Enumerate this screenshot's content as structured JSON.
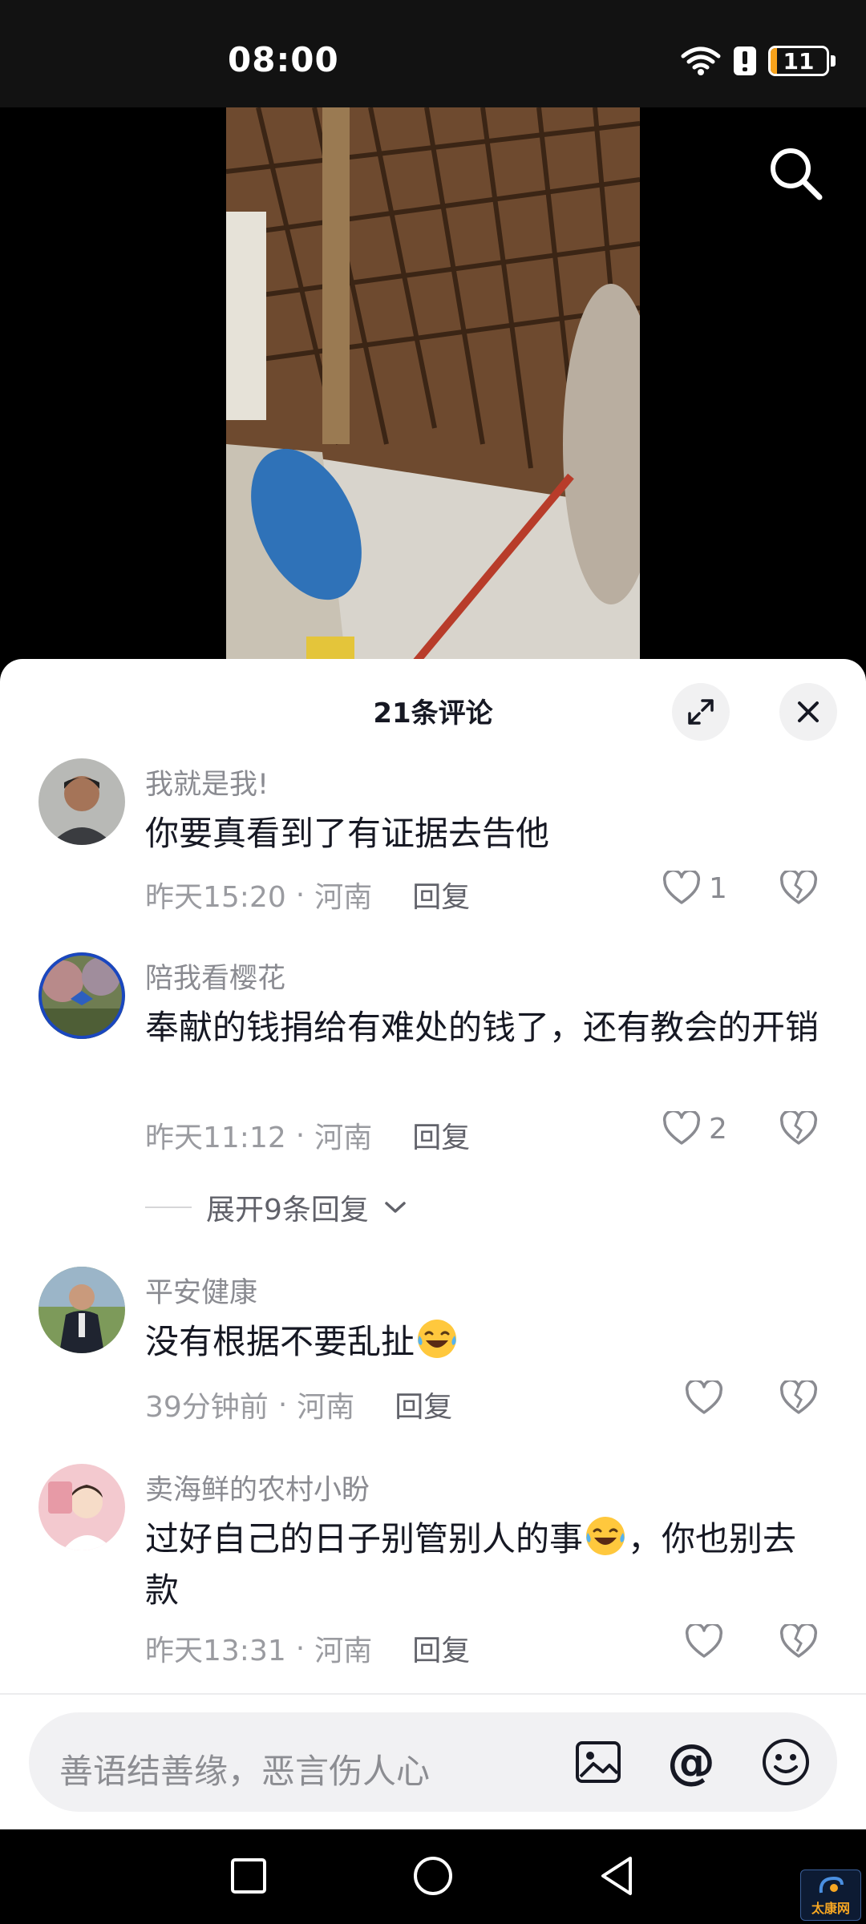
{
  "status_bar": {
    "time": "08:00",
    "battery": "11",
    "battery_color": "#f7a21b"
  },
  "comments_panel": {
    "title": "21条评论",
    "comments": [
      {
        "user": "我就是我!",
        "text": "你要真看到了有证据去告他",
        "time": "昨天15:20",
        "location": "河南",
        "reply_label": "回复",
        "likes": "1"
      },
      {
        "user": "陪我看樱花",
        "text": "奉献的钱捐给有难处的钱了，还有教会的开销",
        "time": "昨天11:12",
        "location": "河南",
        "reply_label": "回复",
        "likes": "2"
      },
      {
        "user": "平安健康",
        "text": "没有根据不要乱扯",
        "time": "39分钟前",
        "location": "河南",
        "reply_label": "回复",
        "likes": ""
      },
      {
        "user": "卖海鲜的农村小盼",
        "text_before": "过好自己的日子别管别人的事",
        "text_after": "，你也别去款",
        "time": "昨天13:31",
        "location": "河南",
        "reply_label": "回复",
        "likes": ""
      }
    ],
    "expand_replies": "展开9条回复",
    "separator": "·"
  },
  "input": {
    "placeholder": "善语结善缘，恶言伤人心",
    "at_symbol": "@"
  },
  "watermark": {
    "text": "太康网"
  }
}
